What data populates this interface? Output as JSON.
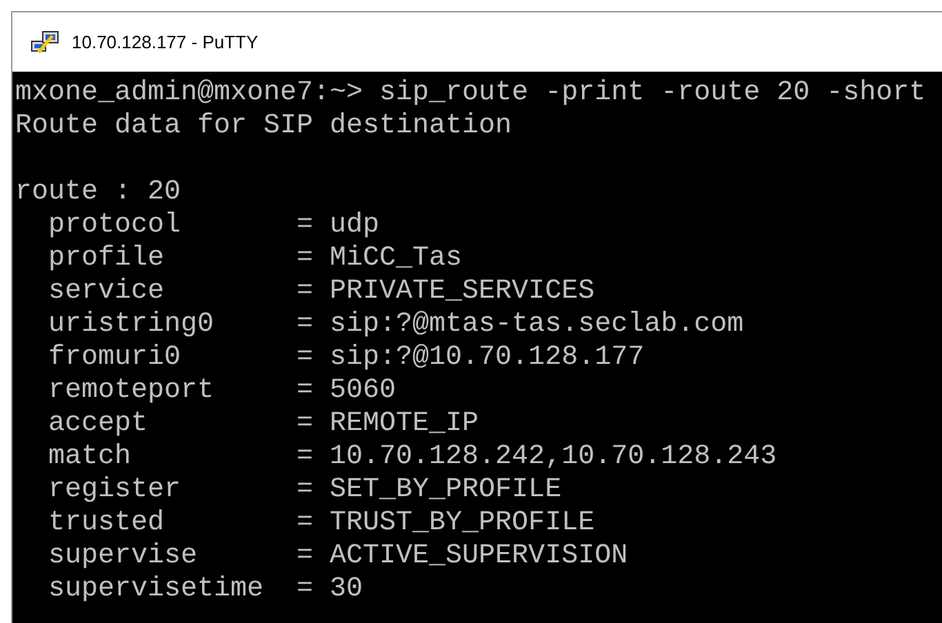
{
  "window": {
    "title": "10.70.128.177 - PuTTY"
  },
  "terminal": {
    "header_lines": [
      "mxone_admin@mxone7:~> sip_route -print -route 20 -short",
      "Route data for SIP destination"
    ],
    "route_lines": [
      "route : 20",
      "  protocol       = udp",
      "  profile        = MiCC_Tas",
      "  service        = PRIVATE_SERVICES",
      "  uristring0     = sip:?@mtas-tas.seclab.com",
      "  fromuri0       = sip:?@10.70.128.177",
      "  remoteport     = 5060",
      "  accept         = REMOTE_IP",
      "  match          = 10.70.128.242,10.70.128.243",
      "  register       = SET_BY_PROFILE",
      "  trusted        = TRUST_BY_PROFILE",
      "  supervise      = ACTIVE_SUPERVISION",
      "  supervisetime  = 30"
    ]
  }
}
